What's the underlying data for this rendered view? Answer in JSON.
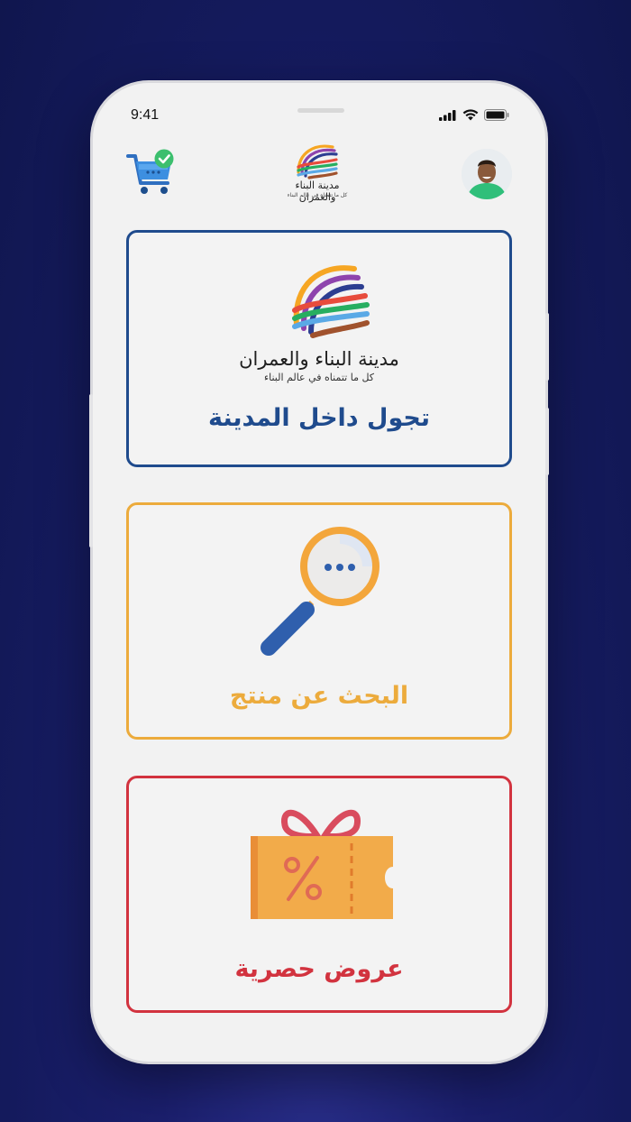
{
  "status_bar": {
    "time": "9:41"
  },
  "brand": {
    "name": "مدينة البناء والعمران",
    "tagline": "كل ما تتمناه في عالم البناء",
    "colors": [
      "#f6a623",
      "#8e44ad",
      "#2c3e91",
      "#e74c3c",
      "#27ae60",
      "#5aa9e6",
      "#a0522d"
    ]
  },
  "header": {
    "cart_icon": "shopping-cart-icon",
    "avatar_icon": "user-avatar"
  },
  "cards": [
    {
      "title": "تجول داخل المدينة",
      "color": "#1f4b8d",
      "icon": "city-logo"
    },
    {
      "title": "البحث عن منتج",
      "color": "#ecab3c",
      "icon": "magnifier-icon"
    },
    {
      "title": "عروض حصرية",
      "color": "#d2333f",
      "icon": "discount-coupon-icon"
    }
  ]
}
